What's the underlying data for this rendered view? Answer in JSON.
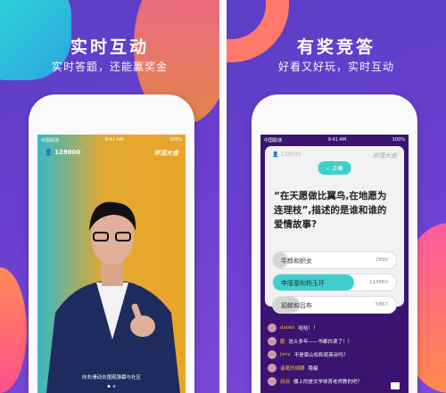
{
  "left": {
    "title": "实时互动",
    "subtitle": "实时答题，还能赢奖金",
    "status": {
      "carrier": "中国联通",
      "time": "9:41 AM",
      "battery": "100%"
    },
    "user_count": "128000",
    "logo": "冲顶大会",
    "hint": "向右滑动去围观弹幕与社区"
  },
  "right": {
    "title": "有奖竞答",
    "subtitle": "好看又好玩，实时互动",
    "status": {
      "carrier": "中国联通",
      "time": "9:41 AM",
      "battery": "100%"
    },
    "user_count": "128000",
    "logo": "冲顶大会",
    "badge": "正确",
    "question": "“在天愿做比翼鸟,在地愿为连理枝”,描述的是谁和谁的爱情故事?",
    "options": [
      {
        "label": "牛郎和织女",
        "count": "2890",
        "share": 0.12,
        "correct": false
      },
      {
        "label": "李隆基和杨玉环",
        "count": "114860",
        "share": 0.66,
        "correct": true
      },
      {
        "label": "貂蝉和吕布",
        "count": "5867",
        "share": 0.22,
        "correct": false
      }
    ],
    "chat": [
      {
        "name": "dalieli",
        "text": "哈哈！！"
      },
      {
        "name": "鹏",
        "text": "这么多年——书都白读了！！"
      },
      {
        "name": "Jony",
        "text": "不是梁山伯和祝英台吗？"
      },
      {
        "name": "诸葛的细腰",
        "text": "稳赢"
      },
      {
        "name": "叔叔",
        "text": "楼上的是文学体育老师教的吧？"
      }
    ]
  },
  "colors": {
    "accent": "#3fcfcf",
    "purple": "#5b3fc4",
    "dark_purple": "#3a1470"
  }
}
